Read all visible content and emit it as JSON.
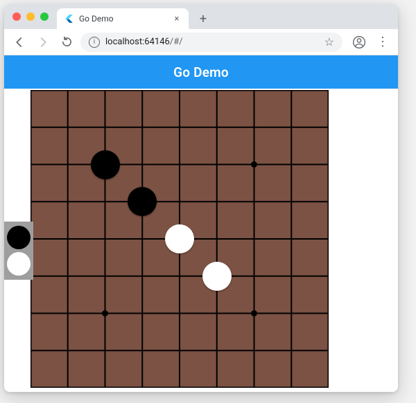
{
  "browser": {
    "tab_title": "Go Demo",
    "url_host": "localhost:64146",
    "url_path": "/#/",
    "close_glyph": "×",
    "new_tab_glyph": "+",
    "star_glyph": "☆",
    "menu_glyph": "⋮"
  },
  "app": {
    "title": "Go Demo"
  },
  "board": {
    "size": 9,
    "star_points": [
      {
        "col": 2,
        "row": 2
      },
      {
        "col": 6,
        "row": 2
      },
      {
        "col": 2,
        "row": 6
      },
      {
        "col": 6,
        "row": 6
      }
    ],
    "stones": [
      {
        "color": "black",
        "col": 2,
        "row": 2
      },
      {
        "color": "black",
        "col": 3,
        "row": 3
      },
      {
        "color": "white",
        "col": 4,
        "row": 4
      },
      {
        "color": "white",
        "col": 5,
        "row": 5
      }
    ]
  },
  "picker": {
    "options": [
      "black",
      "white"
    ],
    "selected": "black"
  },
  "colors": {
    "accent": "#2196F3",
    "board": "#7b5243",
    "grid": "#000000"
  }
}
